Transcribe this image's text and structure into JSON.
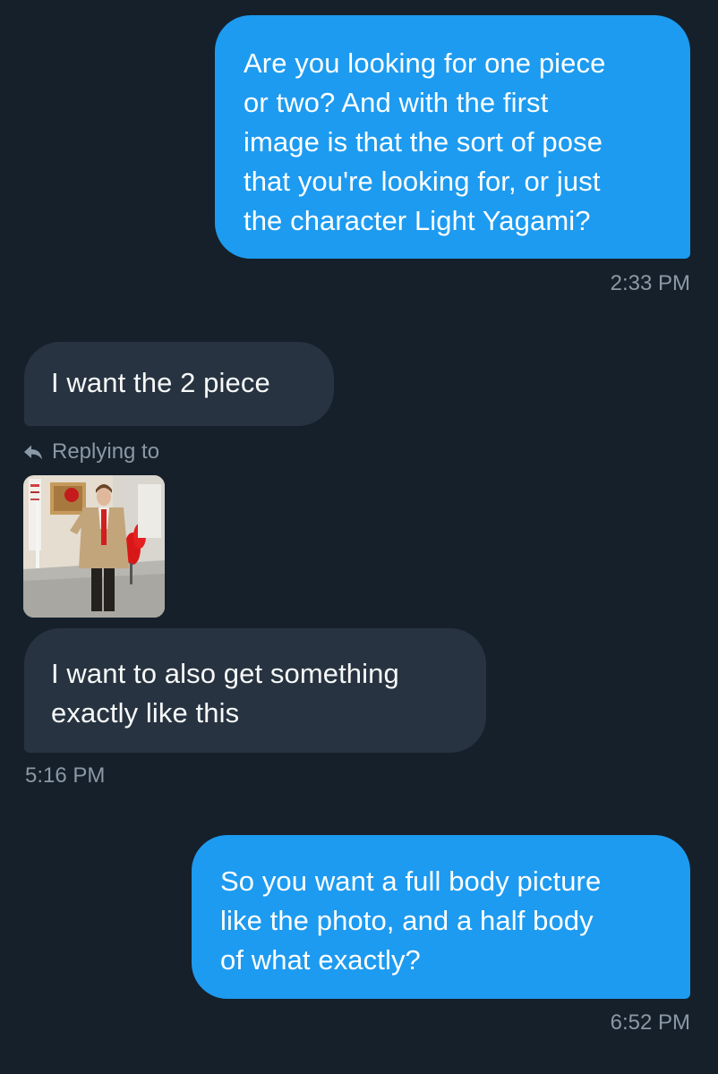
{
  "conversation": {
    "messages": [
      {
        "direction": "outgoing",
        "lines": [
          "Are you looking for one piece",
          "or two? And with the first",
          "image is that the sort of pose",
          "that you're looking for, or just",
          "the character Light Yagami?"
        ],
        "time": "2:33 PM"
      },
      {
        "direction": "incoming",
        "lines": [
          "I want the 2 piece"
        ]
      },
      {
        "direction": "incoming",
        "reply_label": "Replying to",
        "reply_icon": "reply-arrow-icon",
        "lines": [
          "I want to also get something",
          "exactly like this"
        ],
        "time": "5:16 PM"
      },
      {
        "direction": "outgoing",
        "lines": [
          "So you want a full body picture",
          "like the photo, and a half body",
          "of what exactly?"
        ],
        "time": "6:52 PM"
      }
    ]
  },
  "colors": {
    "background": "#15202b",
    "outgoing_bubble": "#1d9bf0",
    "incoming_bubble": "#273340",
    "timestamp": "#8b98a5"
  }
}
